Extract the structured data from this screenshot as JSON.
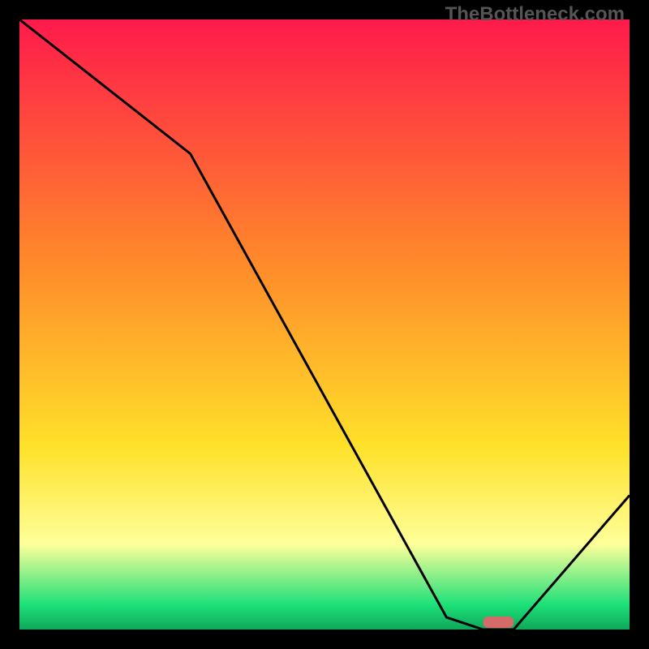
{
  "branding": {
    "watermark": "TheBottleneck.com"
  },
  "colors": {
    "red": "#ff1a4b",
    "orange": "#ff8a2a",
    "yellow": "#ffe12a",
    "paleyellow": "#ffff9a",
    "green": "#1ce078",
    "darkgreen": "#0fa85a",
    "marker": "#d46a6a",
    "frame": "#000000",
    "curve": "#000000"
  },
  "chart_data": {
    "type": "line",
    "title": "",
    "xlabel": "",
    "ylabel": "",
    "xlim": [
      0,
      100
    ],
    "ylim": [
      0,
      100
    ],
    "x": [
      0,
      28,
      70,
      76,
      81,
      100
    ],
    "values": [
      100,
      78,
      2,
      0,
      0,
      22
    ],
    "marker_segment": {
      "x0": 76,
      "x1": 81,
      "y": 0
    },
    "gradient_stops": [
      {
        "pct": 0,
        "color_key": "red"
      },
      {
        "pct": 40,
        "color_key": "orange"
      },
      {
        "pct": 70,
        "color_key": "yellow"
      },
      {
        "pct": 86,
        "color_key": "paleyellow"
      },
      {
        "pct": 96,
        "color_key": "green"
      },
      {
        "pct": 100,
        "color_key": "darkgreen"
      }
    ]
  }
}
